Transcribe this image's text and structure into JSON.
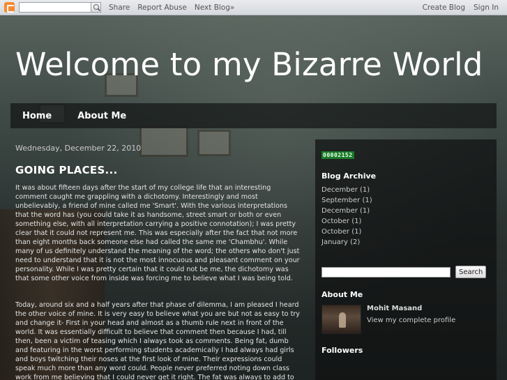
{
  "navbar": {
    "search_placeholder": "",
    "links": [
      "Share",
      "Report Abuse",
      "Next Blog»"
    ],
    "create_blog": "Create Blog",
    "sign_in": "Sign In"
  },
  "header": {
    "title": "Welcome to my Bizarre World"
  },
  "tabs": [
    "Home",
    "About Me"
  ],
  "post": {
    "date": "Wednesday, December 22, 2010",
    "title": "GOING PLACES...",
    "paragraphs": [
      "It was about fifteen days after the start of my college life that an interesting comment caught me grappling with a dichotomy. Interestingly and most unbelievably, a friend of mine called me 'Smart'. With the various interpretations that the word has (you could take it as handsome, street smart or both or even something else, with all interpretation carrying a positive connotation); I was pretty clear that it could not represent me. This was especially after the fact that not more than eight months back someone else had called the same me 'Chambhu'. While many of us definitely understand the meaning of the word; the others who don't just need to understand that it is not the most innocuous and pleasant comment on your personality. While I was pretty certain that it could not be me, the dichotomy was that some other voice from inside was forcing me to believe what I was being told.",
      "Today, around six and a half years after that phase of dilemma, I am pleased I heard the other voice of mine. It is very easy to believe what you are but not as easy to try and change it- First in your head and almost as a thumb rule next in front of the world. It was essentially difficult to believe that comment then because I had, till then, been a victim of teasing which I always took as comments. Being fat, dumb and featuring in the worst performing students academically I had always had girls and boys twitching their noses at the first look of mine. Their expressions could speak much more than any word could. People never preferred noting down class work from me believing that I could never get it right. The fat was always to add to the woes. A tan, sometimes on the"
    ]
  },
  "sidebar": {
    "counter": "00002152",
    "archive_title": "Blog Archive",
    "archive": [
      "December (1)",
      "September (1)",
      "December (1)",
      "October (1)",
      "October (1)",
      "January (2)"
    ],
    "search_button": "Search",
    "about_title": "About Me",
    "profile_name": "Mohit Masand",
    "profile_link": "View my complete profile",
    "followers_title": "Followers"
  }
}
